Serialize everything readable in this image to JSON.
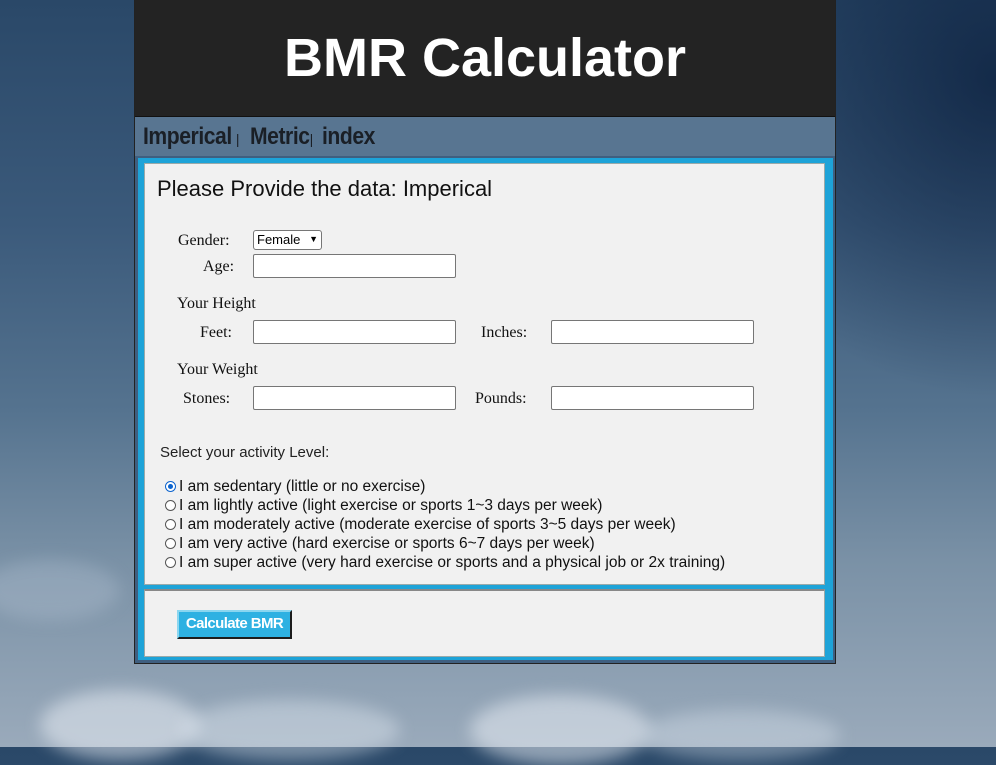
{
  "header": {
    "title": "BMR Calculator"
  },
  "nav": {
    "items": [
      "Imperical",
      "Metric",
      "index"
    ],
    "separator": "|"
  },
  "form": {
    "title": "Please Provide the data: Imperical",
    "gender_label": "Gender:",
    "gender_value": "Female",
    "age_label": "Age:",
    "age_value": "",
    "height_section": "Your Height",
    "feet_label": "Feet:",
    "feet_value": "",
    "inches_label": "Inches:",
    "inches_value": "",
    "weight_section": "Your Weight",
    "stones_label": "Stones:",
    "stones_value": "",
    "pounds_label": "Pounds:",
    "pounds_value": "",
    "activity_title": "Select your activity Level:",
    "activity_options": [
      "I am sedentary (little or no exercise)",
      "I am lightly active (light exercise or sports 1~3 days per week)",
      "I am moderately active (moderate exercise of sports 3~5 days per week)",
      "I am very active (hard exercise or sports 6~7 days per week)",
      "I am super active (very hard exercise or sports and a physical job or 2x training)"
    ],
    "activity_selected_index": 0,
    "submit_label": "Calculate BMR"
  },
  "icons": {
    "select_arrow": "chevron-down-icon"
  },
  "colors": {
    "header_bg": "#232323",
    "nav_bg": "#587591",
    "panel_accent": "#1da3d8",
    "button_bg": "#2eb1e2"
  }
}
